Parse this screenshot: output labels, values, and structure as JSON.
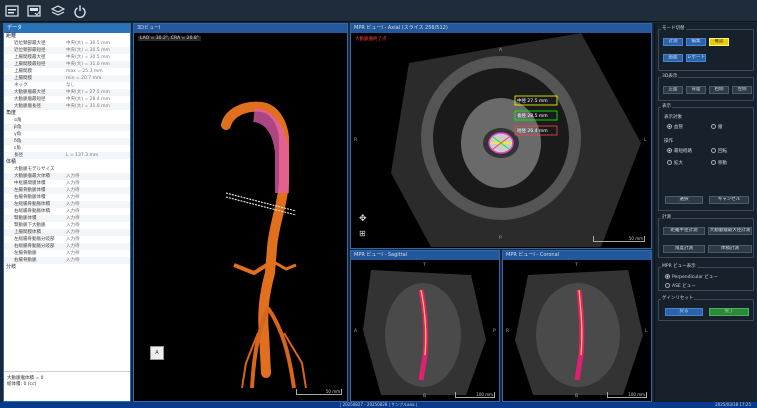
{
  "statusbar": {
    "center": "| 20250827 - 20250828 | サンプルaaa |",
    "datetime": "2025/03/18 17:25"
  },
  "left_panel": {
    "title": "データ",
    "sections": [
      {
        "label": "距離",
        "rows": [
          {
            "k": "近位頸部最大径",
            "v": "中央(大) = 30.5 mm"
          },
          {
            "k": "近位頸部最短径",
            "v": "中央(大) = 30.5 mm"
          },
          {
            "k": "上腸間膜最大径",
            "v": "中央(大) = 30.5 mm"
          },
          {
            "k": "上腸間膜最短径",
            "v": "中央(大) = 31.0 mm"
          },
          {
            "k": "上腸間膜",
            "v": "max = 25.3 mm"
          },
          {
            "k": "上腸間膜",
            "v": "min = 20.7 mm"
          },
          {
            "k": "ネック",
            "v": "なし"
          },
          {
            "k": "大動脈瘤最大径",
            "v": "中央(大) = 27.5 mm"
          },
          {
            "k": "大動脈瘤最短径",
            "v": "中央(大) = 28.4 mm"
          },
          {
            "k": "大動脈瘤長径",
            "v": "中央(大) = 31.0 mm"
          }
        ]
      },
      {
        "label": "角度",
        "rows": [
          {
            "k": "α角",
            "v": ""
          },
          {
            "k": "β角",
            "v": ""
          },
          {
            "k": "γ角",
            "v": ""
          },
          {
            "k": "δ角",
            "v": ""
          },
          {
            "k": "ε角",
            "v": ""
          },
          {
            "k": "長径",
            "v": "L = 137.3 mm"
          }
        ]
      },
      {
        "label": "体積",
        "rows": [
          {
            "k": "大動脈モデルサイズ",
            "v": ""
          },
          {
            "k": "大動脈瘤最大体積",
            "v": "入力待"
          },
          {
            "k": "中枢腸間膜体積",
            "v": "入力待"
          },
          {
            "k": "左腸骨動脈体積",
            "v": "入力待"
          },
          {
            "k": "右腸骨動脈体積",
            "v": "入力待"
          },
          {
            "k": "左総腸骨動脈体積",
            "v": "入力待"
          },
          {
            "k": "右総腸骨動脈体積",
            "v": "入力待"
          },
          {
            "k": "腎動脈体積",
            "v": "入力待"
          },
          {
            "k": "腎動脈下大動脈",
            "v": "入力待"
          },
          {
            "k": "上腸間膜体積",
            "v": "入力待"
          },
          {
            "k": "左総腸骨動脈分岐部",
            "v": "入力待"
          },
          {
            "k": "右総腸骨動脈分岐部",
            "v": "入力待"
          },
          {
            "k": "左腸骨動脈",
            "v": "入力待"
          },
          {
            "k": "右腸骨動脈",
            "v": "入力待"
          }
        ]
      },
      {
        "label": "分岐",
        "rows": []
      }
    ],
    "footer_line1": "大動脈瘤体積 = 0",
    "footer_line2": "総体積: 0 (cc)"
  },
  "view3d": {
    "title": "3DビューI",
    "angle": "LAO = 30.2°, CRA = 20.8°",
    "scale": "50 mm"
  },
  "axial": {
    "title": "MPR ビューI - Axial (スライス 256/512)",
    "overlay": "大動脈瘤終了点",
    "m1": "中径 27.5 mm",
    "m2": "長径 28.5 mm",
    "m3": "短径 26.4 mm",
    "scale": "50 mm",
    "top": "A",
    "left": "R",
    "right": "L",
    "bottom": "P"
  },
  "sagittal": {
    "title": "MPR ビューI - Sagittal",
    "top": "T",
    "bottom": "B",
    "left": "A",
    "right": "P",
    "scale": "100 mm"
  },
  "coronal": {
    "title": "MPR ビューI - Coronal",
    "top": "T",
    "bottom": "B",
    "left": "R",
    "right": "L",
    "scale": "100 mm"
  },
  "right_panel": {
    "g1": {
      "label": "モード切替",
      "b1": "計測",
      "b2": "編集",
      "b3": "確認",
      "b4": "画面",
      "b5": "レポート"
    },
    "g2": {
      "label": "3D表示",
      "b1": "正面",
      "b2": "背面",
      "b3": "右側",
      "b4": "左側"
    },
    "g3": {
      "label": "表示",
      "sub1": "表示対象",
      "r1": "血管",
      "r2": "瘤",
      "sub2": "操作",
      "r3": "最短経路",
      "r4": "回転",
      "r5": "拡大",
      "r6": "移動",
      "b1": "選択",
      "b2": "キャンセル"
    },
    "g4": {
      "label": "計測",
      "b1": "距離半径計測",
      "b2": "大動脈瘤最大径計測",
      "b3": "角度計測",
      "b4": "体積計測"
    },
    "g5": {
      "label": "MPR ビュー表示",
      "r1": "Perpendicular ビュー",
      "r2": "ASE ビュー"
    },
    "g6": {
      "label": "ゲインリセット",
      "b1": "戻る",
      "b2": "完了"
    }
  }
}
